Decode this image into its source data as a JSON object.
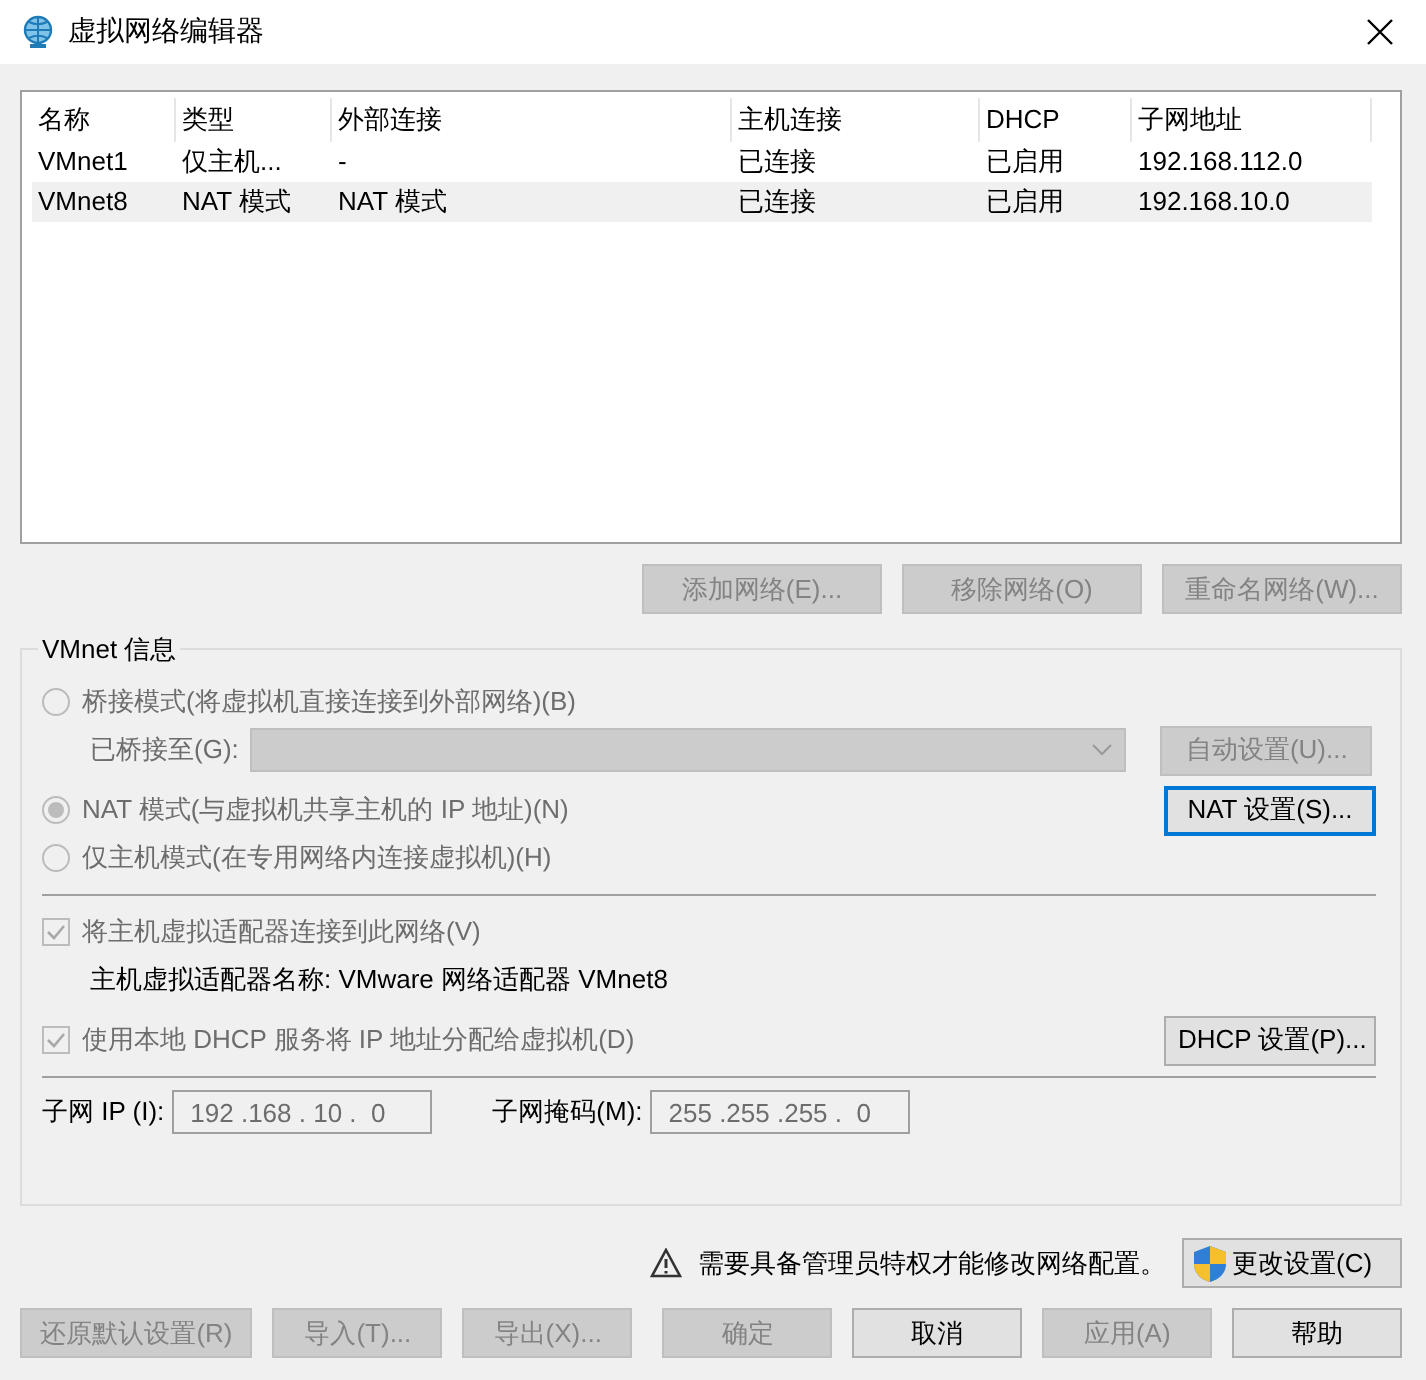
{
  "window": {
    "title": "虚拟网络编辑器"
  },
  "table": {
    "columns": [
      "名称",
      "类型",
      "外部连接",
      "主机连接",
      "DHCP",
      "子网地址"
    ],
    "rows": [
      {
        "cells": [
          "VMnet1",
          "仅主机...",
          "-",
          "已连接",
          "已启用",
          "192.168.112.0"
        ],
        "selected": false
      },
      {
        "cells": [
          "VMnet8",
          "NAT 模式",
          "NAT 模式",
          "已连接",
          "已启用",
          "192.168.10.0"
        ],
        "selected": true
      }
    ]
  },
  "network_buttons": [
    {
      "label": "添加网络(E)...",
      "disabled": true
    },
    {
      "label": "移除网络(O)",
      "disabled": true
    },
    {
      "label": "重命名网络(W)...",
      "disabled": true
    }
  ],
  "vmnet_info": {
    "title": "VMnet 信息",
    "bridged": {
      "label": "桥接模式(将虚拟机直接连接到外部网络)(B)",
      "selected": false,
      "disabled": true
    },
    "bridged_to": {
      "label": "已桥接至(G):",
      "disabled": true
    },
    "auto_button": {
      "label": "自动设置(U)...",
      "disabled": true
    },
    "nat": {
      "label": "NAT 模式(与虚拟机共享主机的 IP 地址)(N)",
      "selected": true,
      "disabled": true
    },
    "nat_button": {
      "label": "NAT 设置(S)...",
      "disabled": false,
      "focused": true
    },
    "host_only": {
      "label": "仅主机模式(在专用网络内连接虚拟机)(H)",
      "selected": false,
      "disabled": true
    },
    "connect_adapter": {
      "label": "将主机虚拟适配器连接到此网络(V)",
      "checked": true,
      "disabled": true
    },
    "adapter_name": "主机虚拟适配器名称: VMware 网络适配器 VMnet8",
    "use_dhcp": {
      "label": "使用本地 DHCP 服务将 IP 地址分配给虚拟机(D)",
      "checked": true,
      "disabled": true
    },
    "dhcp_button": {
      "label": "DHCP 设置(P)...",
      "disabled": false,
      "focused": false
    },
    "subnet_ip": {
      "label": "子网 IP (I):",
      "value": "192 .168 . 10 .  0",
      "disabled": true
    },
    "subnet_mask": {
      "label": "子网掩码(M):",
      "value": "255 .255 .255 .  0",
      "disabled": true
    }
  },
  "admin_notice": {
    "text": "需要具备管理员特权才能修改网络配置。",
    "button": "更改设置(C)"
  },
  "footer_buttons": [
    {
      "label": "还原默认设置(R)",
      "disabled": true
    },
    {
      "label": "导入(T)...",
      "disabled": true
    },
    {
      "label": "导出(X)...",
      "disabled": true
    },
    {
      "label": "确定",
      "disabled": true
    },
    {
      "label": "取消",
      "disabled": false
    },
    {
      "label": "应用(A)",
      "disabled": true
    },
    {
      "label": "帮助",
      "disabled": false
    }
  ]
}
